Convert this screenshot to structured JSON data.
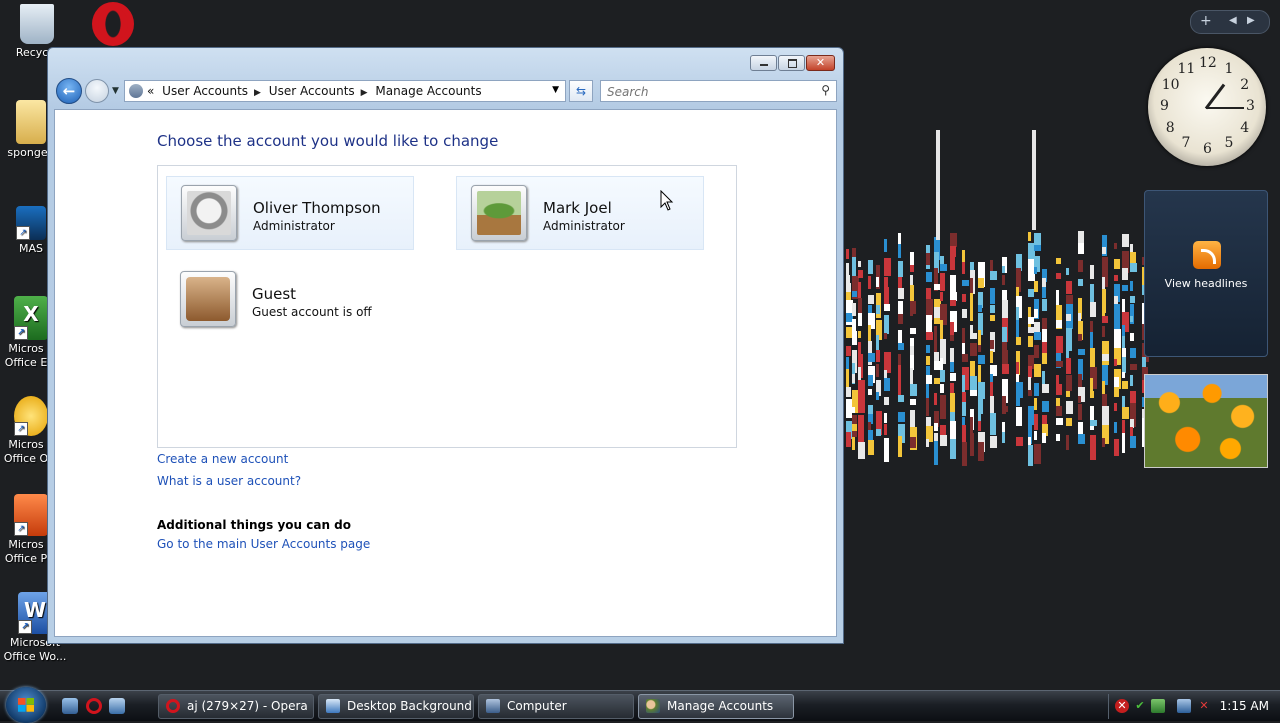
{
  "desktop": {
    "icons": [
      {
        "label": "Recycle",
        "icon": "recycle-bin-icon"
      },
      {
        "label": "spongeb",
        "icon": "folder-icon"
      },
      {
        "label": "MAS",
        "icon": "shortcut-icon"
      },
      {
        "label": "Micros Office E",
        "icon": "excel-icon"
      },
      {
        "label": "Micros Office O",
        "icon": "outlook-icon"
      },
      {
        "label": "Micros Office P",
        "icon": "powerpoint-icon"
      },
      {
        "label": "Microsoft Office Wo...",
        "icon": "word-icon"
      }
    ],
    "opera_icon": "opera-icon"
  },
  "gadgets": {
    "feed_label": "View headlines",
    "clock_numbers": [
      "12",
      "1",
      "2",
      "3",
      "4",
      "5",
      "6",
      "7",
      "8",
      "9",
      "10",
      "11"
    ]
  },
  "window": {
    "address": {
      "chevron": "«",
      "crumbs": [
        "User Accounts",
        "User Accounts",
        "Manage Accounts"
      ]
    },
    "search_placeholder": "Search",
    "heading": "Choose the account you would like to change",
    "accounts": [
      {
        "name": "Oliver Thompson",
        "role": "Administrator",
        "picture": "robot-avatar"
      },
      {
        "name": "Mark Joel",
        "role": "Administrator",
        "picture": "chameleon-avatar"
      },
      {
        "name": "Guest",
        "role": "Guest account is off",
        "picture": "briefcase-avatar"
      }
    ],
    "links": {
      "create": "Create a new account",
      "what": "What is a user account?"
    },
    "additional_heading": "Additional things you can do",
    "main_page_link": "Go to the main User Accounts page"
  },
  "taskbar": {
    "tasks": [
      {
        "label": "aj (279×27) - Opera",
        "icon": "opera-icon"
      },
      {
        "label": "Desktop Background",
        "icon": "monitor-icon"
      },
      {
        "label": "Computer",
        "icon": "computer-icon"
      },
      {
        "label": "Manage Accounts",
        "icon": "users-icon"
      }
    ],
    "clock": "1:15 AM"
  }
}
